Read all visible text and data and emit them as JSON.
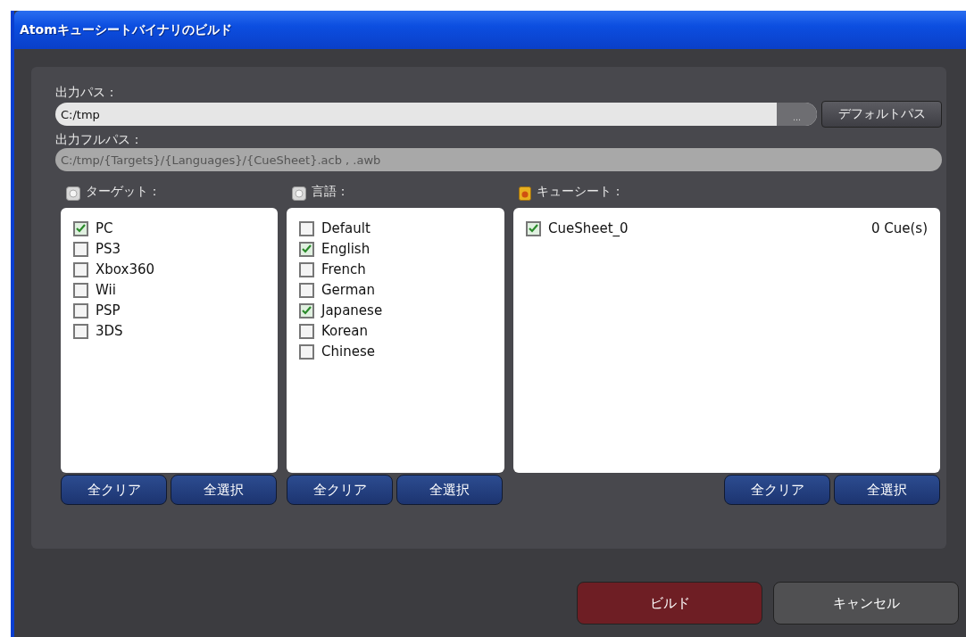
{
  "window": {
    "title": "Atomキューシートバイナリのビルド"
  },
  "output_path": {
    "label": "出力パス：",
    "value": "C:/tmp",
    "browse": "...",
    "default_button": "デフォルトパス"
  },
  "full_path": {
    "label": "出力フルパス：",
    "value": "C:/tmp/{Targets}/{Languages}/{CueSheet}.acb , .awb"
  },
  "sections": [
    {
      "kind": "disc",
      "title": "ターゲット：",
      "items": [
        {
          "label": "PC",
          "checked": true
        },
        {
          "label": "PS3",
          "checked": false
        },
        {
          "label": "Xbox360",
          "checked": false
        },
        {
          "label": "Wii",
          "checked": false
        },
        {
          "label": "PSP",
          "checked": false
        },
        {
          "label": "3DS",
          "checked": false
        }
      ],
      "buttons": [
        "全クリア",
        "全選択"
      ]
    },
    {
      "kind": "disc",
      "title": "言語：",
      "items": [
        {
          "label": "Default",
          "checked": false
        },
        {
          "label": "English",
          "checked": true
        },
        {
          "label": "French",
          "checked": false
        },
        {
          "label": "German",
          "checked": false
        },
        {
          "label": "Japanese",
          "checked": true
        },
        {
          "label": "Korean",
          "checked": false
        },
        {
          "label": "Chinese",
          "checked": false
        }
      ],
      "buttons": [
        "全クリア",
        "全選択"
      ]
    },
    {
      "kind": "sheet",
      "title": "キューシート：",
      "items": [
        {
          "label": "CueSheet_0",
          "checked": true,
          "count": "0 Cue(s)"
        }
      ],
      "buttons": [
        "全クリア",
        "全選択"
      ]
    }
  ],
  "footer": {
    "build": "ビルド",
    "cancel": "キャンセル"
  }
}
